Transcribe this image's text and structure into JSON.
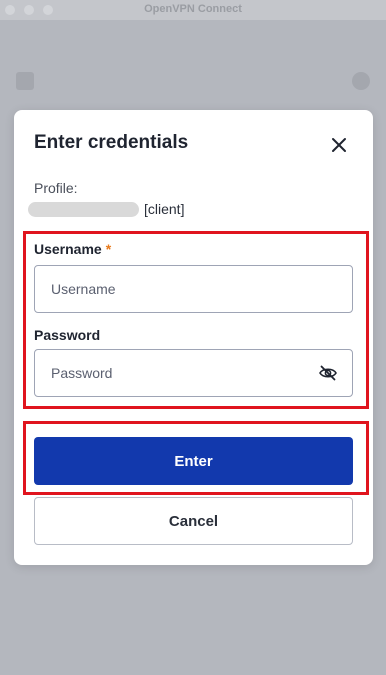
{
  "window": {
    "title": "OpenVPN Connect"
  },
  "dialog": {
    "title": "Enter credentials",
    "profile_label": "Profile:",
    "profile_suffix": "[client]",
    "username": {
      "label": "Username",
      "required_marker": "*",
      "value": "",
      "placeholder": "Username"
    },
    "password": {
      "label": "Password",
      "value": "",
      "placeholder": "Password",
      "visibility_icon": "eye-off-icon"
    },
    "enter_label": "Enter",
    "cancel_label": "Cancel"
  },
  "colors": {
    "primary_button": "#1239ad",
    "required_marker": "#e8791a",
    "highlight_outline": "#e0141e",
    "overlay_background": "#b6b9c0"
  }
}
